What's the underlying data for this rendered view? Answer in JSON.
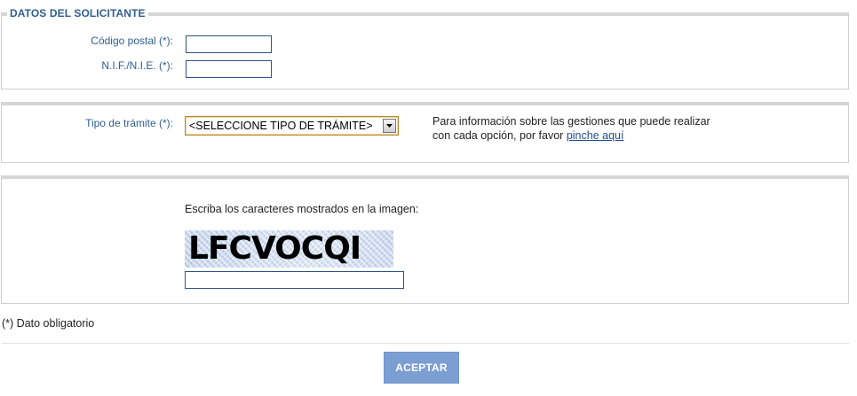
{
  "solicitante": {
    "legend": "DATOS DEL SOLICITANTE",
    "codigo_postal": {
      "label": "Código postal (*):",
      "value": ""
    },
    "nif": {
      "label": "N.I.F./N.I.E. (*):",
      "value": ""
    }
  },
  "tramite": {
    "label": "Tipo de trámite (*):",
    "selected": "<SELECCIONE TIPO DE TRÁMITE>",
    "info_text": "Para información sobre las gestiones que puede realizar con cada opción, por favor",
    "info_link": "pinche aquí"
  },
  "captcha": {
    "prompt": "Escriba los caracteres mostrados en la imagen:",
    "image_text": "LFCVOCQI",
    "value": ""
  },
  "footer": {
    "required_note": "(*) Dato obligatorio",
    "accept_label": "ACEPTAR"
  },
  "colors": {
    "label_blue": "#2f5f8f",
    "button_bg": "#7b9ed3",
    "link": "#1f4e8c"
  },
  "icons": {
    "select_arrow": "chevron-down-icon"
  }
}
